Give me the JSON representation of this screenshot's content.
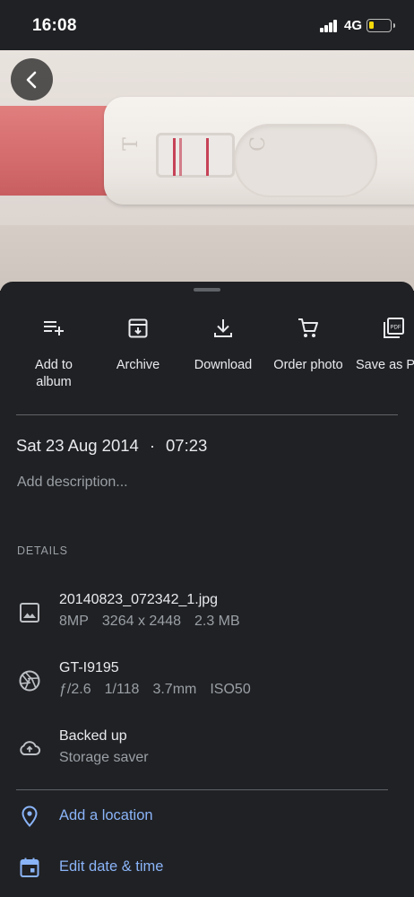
{
  "status_bar": {
    "time": "16:08",
    "network": "4G",
    "icons": [
      "signal-icon",
      "battery-icon"
    ]
  },
  "photo": {
    "test_letters": [
      "T",
      "C"
    ]
  },
  "navigation": {
    "back_icon": "chevron-left-icon"
  },
  "actions": [
    {
      "label": "Add to\nalbum",
      "icon": "playlist-add-icon"
    },
    {
      "label": "Archive",
      "icon": "archive-icon"
    },
    {
      "label": "Download",
      "icon": "download-icon"
    },
    {
      "label": "Order photo",
      "icon": "cart-icon"
    },
    {
      "label": "Save as P",
      "icon": "pdf-icon"
    }
  ],
  "info": {
    "date": "Sat 23 Aug 2014",
    "separator": "·",
    "time": "07:23",
    "description_placeholder": "Add description..."
  },
  "details": {
    "heading": "DETAILS",
    "file": {
      "name": "20140823_072342_1.jpg",
      "megapixels": "8MP",
      "resolution": "3264 x 2448",
      "size": "2.3 MB"
    },
    "camera": {
      "model": "GT-I9195",
      "aperture": "ƒ/2.6",
      "exposure": "1/118",
      "focal_length": "3.7mm",
      "iso": "ISO50"
    },
    "backup": {
      "status": "Backed up",
      "quality": "Storage saver"
    }
  },
  "links": {
    "location": "Add a location",
    "edit_datetime": "Edit date & time"
  },
  "colors": {
    "background": "#202124",
    "text": "#e8eaed",
    "secondary_text": "#9aa0a6",
    "link": "#8ab4f8"
  }
}
